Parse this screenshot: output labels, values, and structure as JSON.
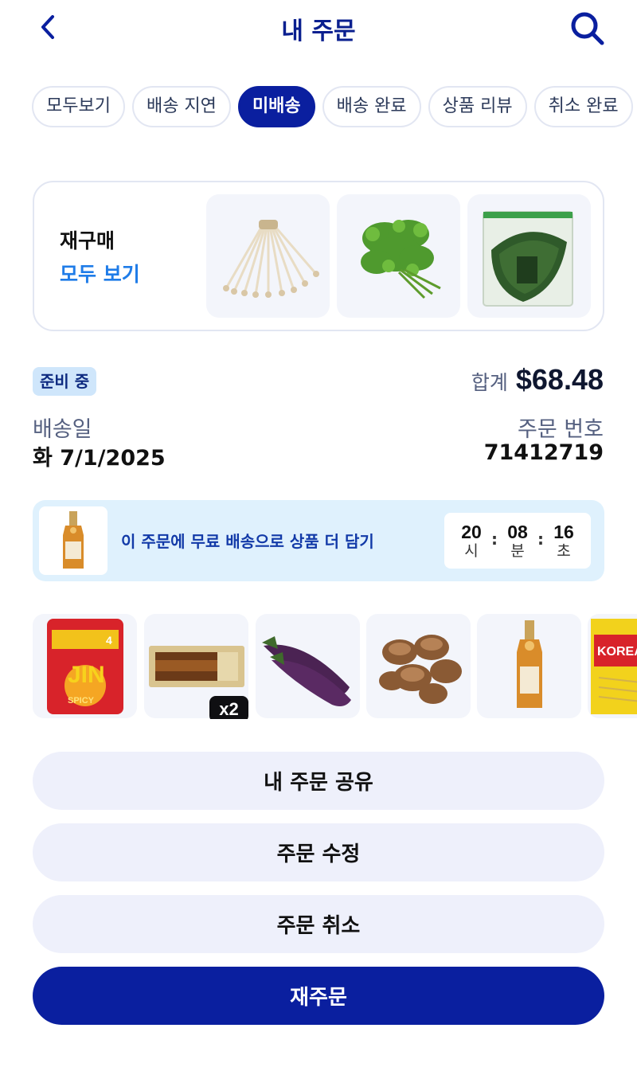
{
  "header": {
    "title": "내 주문",
    "back_icon": "chevron-left-icon",
    "search_icon": "search-icon"
  },
  "tabs": [
    {
      "label": "모두보기",
      "active": false
    },
    {
      "label": "배송 지연",
      "active": false
    },
    {
      "label": "미배송",
      "active": true
    },
    {
      "label": "배송 완료",
      "active": false
    },
    {
      "label": "상품 리뷰",
      "active": false
    },
    {
      "label": "취소 완료",
      "active": false
    }
  ],
  "reorder": {
    "title": "재구매",
    "view_all": "모두 보기",
    "items": [
      "enoki-mushroom",
      "crown-daisy",
      "perilla-leaves"
    ]
  },
  "order": {
    "status": "준비 중",
    "total_label": "합계",
    "total_value": "$68.48",
    "delivery_label": "배송일",
    "delivery_value": "화 7/1/2025",
    "order_number_label": "주문 번호",
    "order_number_value": "71412719"
  },
  "promo": {
    "text": "이 주문에 무료 배송으로 상품 더 담기",
    "timer": {
      "hours": "20",
      "hours_label": "시",
      "minutes": "08",
      "minutes_label": "분",
      "seconds": "16",
      "seconds_label": "초"
    }
  },
  "products": {
    "items": [
      "jin-ramen-spicy",
      "grilled-eel",
      "eggplant",
      "shiitake-mushroom",
      "bellflower-liquor",
      "korean-glass-noodles"
    ],
    "ramen_brand": "JIN",
    "ramen_flavor": "SPICY",
    "ramen_count": "4",
    "noodle_label": "KOREAN",
    "qty_badge": "x2"
  },
  "actions": {
    "share": "내 주문 공유",
    "edit": "주문 수정",
    "cancel": "주문 취소",
    "reorder": "재주문"
  },
  "colors": {
    "brand": "#0a1f9f",
    "link": "#1f7ce8",
    "badge_bg": "#cfe6fb",
    "promo_bg": "#dff1fd",
    "button_bg": "#eef0fb"
  }
}
